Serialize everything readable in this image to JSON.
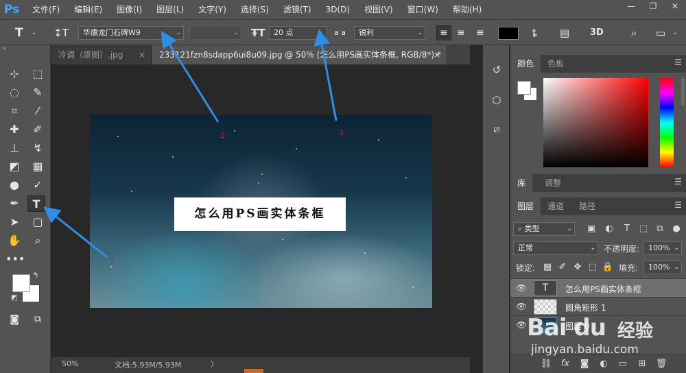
{
  "app": {
    "logo": "Ps"
  },
  "menu": [
    "文件(F)",
    "编辑(E)",
    "图像(I)",
    "图层(L)",
    "文字(Y)",
    "选择(S)",
    "滤镜(T)",
    "3D(D)",
    "视图(V)",
    "窗口(W)",
    "帮助(H)"
  ],
  "window_controls": {
    "minimize": "—",
    "restore": "❐",
    "close": "✕"
  },
  "options": {
    "font_family": "华康龙门石碑W9",
    "font_style": "",
    "font_size": "20 点",
    "antialias_icon_text": "a a",
    "antialias": "锐利",
    "mode_3d": "3D",
    "text_color": "#000000"
  },
  "tabs": [
    {
      "label": "冷调（原图）.jpg",
      "close": "×"
    },
    {
      "label": "233121fzn8sdapp6ui8u09.jpg @ 50% (怎么用PS画实体条框, RGB/8*) *",
      "close": "×"
    }
  ],
  "canvas": {
    "text_layer_content": "怎么用PS画实体条框",
    "annotations": [
      "1",
      "2",
      "3"
    ]
  },
  "status": {
    "zoom": "50%",
    "doc_info": "文档:5.93M/5.93M",
    "arrow": "〉"
  },
  "color_panel": {
    "tabs": [
      "颜色",
      "色板"
    ],
    "fg": "#ffffff",
    "bg": "#ffffff"
  },
  "library_panel": {
    "tabs": [
      "库",
      "调整"
    ]
  },
  "layers_panel": {
    "tabs": [
      "图层",
      "通道",
      "路径"
    ],
    "filter_label": "类型",
    "blend_mode": "正常",
    "opacity_label": "不透明度:",
    "opacity_value": "100%",
    "lock_label": "锁定:",
    "fill_label": "填充:",
    "fill_value": "100%",
    "layers": [
      {
        "name": "怎么用PS画实体条框",
        "thumb_label": "T",
        "selected": true
      },
      {
        "name": "圆角矩形 1",
        "thumb_label": "",
        "selected": false
      },
      {
        "name": "图层 0",
        "thumb_label": "",
        "selected": false
      }
    ],
    "footer_fx": "fx"
  },
  "watermark": {
    "logo": "Bai du",
    "brand": "经验",
    "url": "jingyan.baidu.com"
  }
}
